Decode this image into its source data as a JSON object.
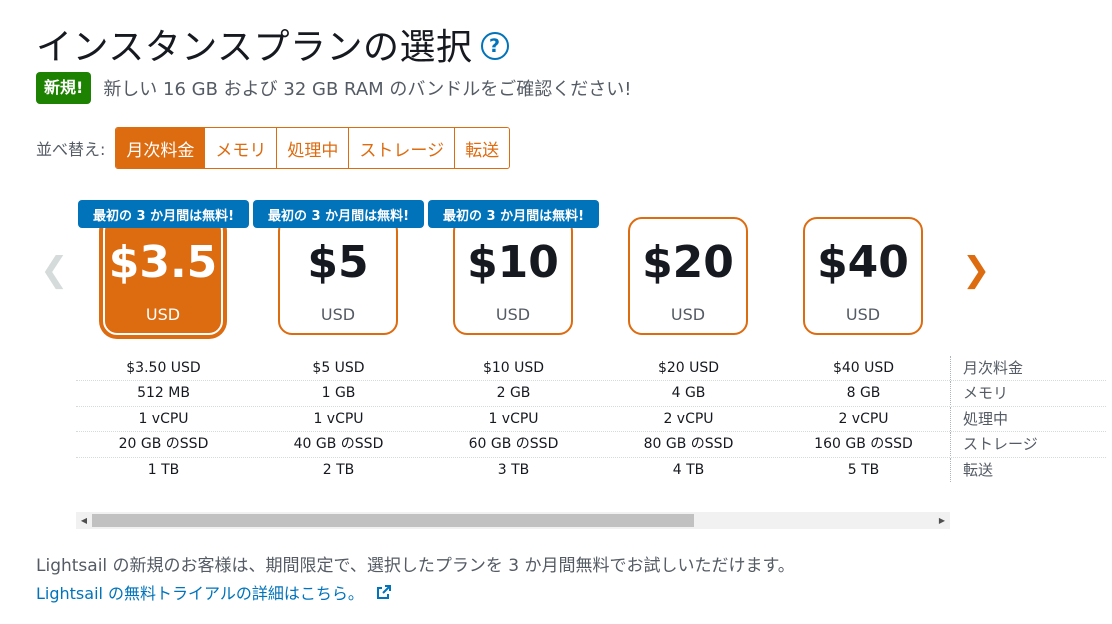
{
  "header": {
    "title": "インスタンスプランの選択",
    "help_icon": "?"
  },
  "notice": {
    "badge": "新規!",
    "text": "新しい 16 GB および 32 GB RAM のバンドルをご確認ください!"
  },
  "sort": {
    "label": "並べ替え:",
    "options": [
      "月次料金",
      "メモリ",
      "処理中",
      "ストレージ",
      "転送"
    ],
    "selected": "月次料金"
  },
  "plans": [
    {
      "price": "$3.5",
      "currency": "USD",
      "badge": "最初の 3 か月間は無料!",
      "selected": true
    },
    {
      "price": "$5",
      "currency": "USD",
      "badge": "最初の 3 か月間は無料!",
      "selected": false
    },
    {
      "price": "$10",
      "currency": "USD",
      "badge": "最初の 3 か月間は無料!",
      "selected": false
    },
    {
      "price": "$20",
      "currency": "USD",
      "badge": "",
      "selected": false
    },
    {
      "price": "$40",
      "currency": "USD",
      "badge": "",
      "selected": false
    }
  ],
  "specs": {
    "labels": [
      "月次料金",
      "メモリ",
      "処理中",
      "ストレージ",
      "転送"
    ],
    "rows": [
      [
        "$3.50 USD",
        "$5 USD",
        "$10 USD",
        "$20 USD",
        "$40 USD"
      ],
      [
        "512 MB",
        "1 GB",
        "2 GB",
        "4 GB",
        "8 GB"
      ],
      [
        "1 vCPU",
        "1 vCPU",
        "1 vCPU",
        "2 vCPU",
        "2 vCPU"
      ],
      [
        "20 GB のSSD",
        "40 GB のSSD",
        "60 GB のSSD",
        "80 GB のSSD",
        "160 GB のSSD"
      ],
      [
        "1 TB",
        "2 TB",
        "3 TB",
        "4 TB",
        "5 TB"
      ]
    ]
  },
  "footer": {
    "text": "Lightsail の新規のお客様は、期間限定で、選択したプランを 3 か月間無料でお試しいただけます。",
    "link": "Lightsail の無料トライアルの詳細はこちら。"
  },
  "colors": {
    "accent": "#dd6b10",
    "link": "#0073bb",
    "new": "#1d8102"
  }
}
